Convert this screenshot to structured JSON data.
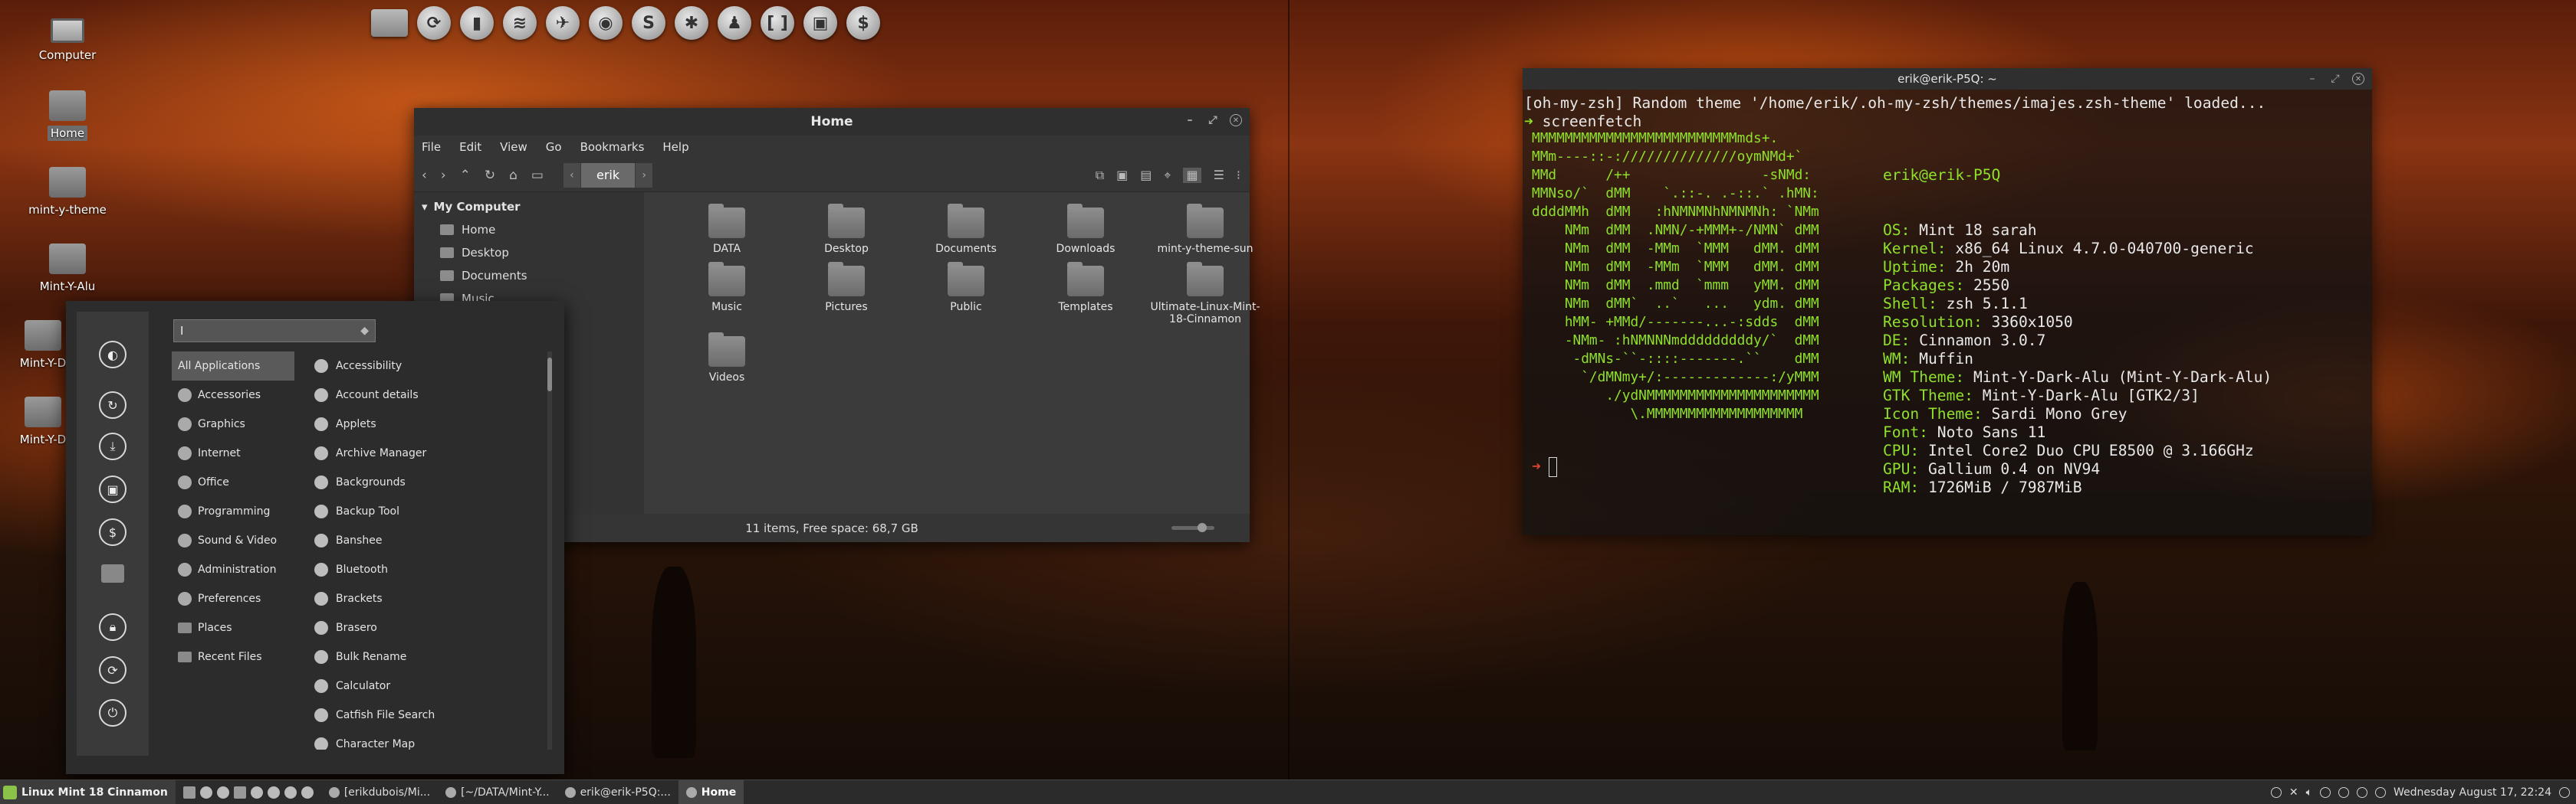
{
  "desktop_icons": [
    {
      "label": "Computer",
      "selected": false
    },
    {
      "label": "Home",
      "selected": true
    },
    {
      "label": "mint-y-theme",
      "selected": false
    },
    {
      "label": "Mint-Y-Alu",
      "selected": false
    },
    {
      "label": "Mint-Y-D",
      "selected": false
    },
    {
      "label": "Mint-Y-D",
      "selected": false
    }
  ],
  "dock": {
    "icons": [
      "folder-icon",
      "updates-icon",
      "terminal-icon",
      "spotify-icon",
      "hexchat-icon",
      "vlc-icon",
      "skype-icon",
      "settings-icon",
      "user-icon",
      "brackets-icon",
      "screenshot-icon",
      "money-icon"
    ],
    "glyphs": [
      "",
      "⟳",
      "▮",
      "≋",
      "✈",
      "◉",
      "S",
      "✱",
      "♟",
      "[ ]",
      "▣",
      "$"
    ]
  },
  "file_manager": {
    "title": "Home",
    "menu": [
      "File",
      "Edit",
      "View",
      "Go",
      "Bookmarks",
      "Help"
    ],
    "breadcrumb": "erik",
    "sidebar_header": "My Computer",
    "sidebar_items": [
      "Home",
      "Desktop",
      "Documents",
      "Music"
    ],
    "items": [
      "DATA",
      "Desktop",
      "Documents",
      "Downloads",
      "mint-y-theme-sun",
      "Music",
      "Pictures",
      "Public",
      "Templates",
      "Ultimate-Linux-Mint-18-Cinnamon",
      "Videos"
    ],
    "status": "11 items, Free space: 68,7 GB"
  },
  "menu": {
    "search_value": "I",
    "categories": [
      {
        "label": "All Applications",
        "selected": true
      },
      {
        "label": "Accessories"
      },
      {
        "label": "Graphics"
      },
      {
        "label": "Internet"
      },
      {
        "label": "Office"
      },
      {
        "label": "Programming"
      },
      {
        "label": "Sound & Video"
      },
      {
        "label": "Administration"
      },
      {
        "label": "Preferences"
      },
      {
        "label": "Places"
      },
      {
        "label": "Recent Files"
      }
    ],
    "apps": [
      "Accessibility",
      "Account details",
      "Applets",
      "Archive Manager",
      "Backgrounds",
      "Backup Tool",
      "Banshee",
      "Bluetooth",
      "Brackets",
      "Brasero",
      "Bulk Rename",
      "Calculator",
      "Catfish File Search",
      "Character Map"
    ],
    "favorites": [
      "firefox-icon",
      "updates-icon",
      "install-icon",
      "screenshot-icon",
      "money-icon",
      "folder-icon",
      "lock-icon",
      "logout-icon",
      "power-icon"
    ]
  },
  "terminal": {
    "title": "erik@erik-P5Q: ~",
    "line1": "[oh-my-zsh] Random theme '/home/erik/.oh-my-zsh/themes/imajes.zsh-theme' loaded...",
    "command": "screenfetch",
    "ascii": [
      "MMMMMMMMMMMMMMMMMMMMMMMMMmds+.",
      "MMm----::-://////////////oymNMd+`",
      "MMd      /++                -sNMd:",
      "MMNso/`  dMM    `.::-. .-::.` .hMN:",
      "ddddMMh  dMM   :hNMNMNhNMNMNh: `NMm",
      "    NMm  dMM  .NMN/-+MMM+-/NMN` dMM",
      "    NMm  dMM  -MMm  `MMM   dMM. dMM",
      "    NMm  dMM  -MMm  `MMM   dMM. dMM",
      "    NMm  dMM  .mmd  `mmm   yMM. dMM",
      "    NMm  dMM`  ..`   ...   ydm. dMM",
      "    hMM- +MMd/-------...-:sdds  dMM",
      "    -NMm- :hNMNNNmdddddddddy/`  dMM",
      "     -dMNs-``-::::-------.``    dMM",
      "      `/dMNmy+/:-------------:/yMMM",
      "         ./ydNMMMMMMMMMMMMMMMMMMMMM",
      "            \\.MMMMMMMMMMMMMMMMMMM"
    ],
    "user_host": "erik@erik-P5Q",
    "info": [
      {
        "k": "OS:",
        "v": " Mint 18 sarah"
      },
      {
        "k": "Kernel:",
        "v": " x86_64 Linux 4.7.0-040700-generic"
      },
      {
        "k": "Uptime:",
        "v": " 2h 20m"
      },
      {
        "k": "Packages:",
        "v": " 2550"
      },
      {
        "k": "Shell:",
        "v": " zsh 5.1.1"
      },
      {
        "k": "Resolution:",
        "v": " 3360x1050"
      },
      {
        "k": "DE:",
        "v": " Cinnamon 3.0.7"
      },
      {
        "k": "WM:",
        "v": " Muffin"
      },
      {
        "k": "WM Theme:",
        "v": " Mint-Y-Dark-Alu (Mint-Y-Dark-Alu)"
      },
      {
        "k": "GTK Theme:",
        "v": " Mint-Y-Dark-Alu [GTK2/3]"
      },
      {
        "k": "Icon Theme:",
        "v": " Sardi Mono Grey"
      },
      {
        "k": "Font:",
        "v": " Noto Sans 11"
      },
      {
        "k": "CPU:",
        "v": " Intel Core2 Duo CPU E8500 @ 3.166GHz"
      },
      {
        "k": "GPU:",
        "v": " Gallium 0.4 on NV94"
      },
      {
        "k": "RAM:",
        "v": " 1726MiB / 7987MiB"
      }
    ]
  },
  "taskbar": {
    "start_label": "Linux Mint 18 Cinnamon",
    "windows": [
      {
        "label": "[erikdubois/Mi...",
        "active": false
      },
      {
        "label": "[~/DATA/Mint-Y...",
        "active": false
      },
      {
        "label": "erik@erik-P5Q:...",
        "active": false
      },
      {
        "label": "Home",
        "active": true
      }
    ],
    "clock": "Wednesday August 17, 22:24"
  }
}
